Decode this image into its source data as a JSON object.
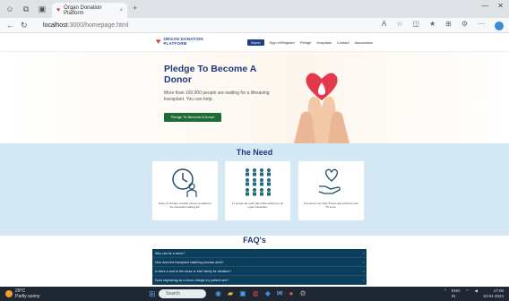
{
  "browser": {
    "tab_title": "Organ Donation Platform",
    "tab_close": "×",
    "new_tab": "+",
    "url_host": "localhost",
    "url_rest": ":3000/homepage.html",
    "win_min": "—",
    "win_close": "✕"
  },
  "site": {
    "logo_line1": "ORGAN DONATION",
    "logo_line2": "PLATFORM",
    "menu": [
      "Home",
      "Sign in/Register",
      "Pledge",
      "Hospitals",
      "Contact",
      "Association"
    ]
  },
  "hero": {
    "title": "Pledge To Become A Donor",
    "subtitle": "More than 100,000 people are waiting for a lifesaving transplant. You can help.",
    "cta": "Pledge To Become A Donor"
  },
  "need": {
    "title": "The Need",
    "cards": [
      {
        "icon": "clock-person-icon",
        "text": "Every 9 minutes, another person is added to the transplant waiting list."
      },
      {
        "icon": "people-group-icon",
        "text": "17 people die each day while waiting for an organ transplant."
      },
      {
        "icon": "heart-hand-icon",
        "text": "One donor can save 8 lives and enhance over 75 more."
      }
    ]
  },
  "faq": {
    "title": "FAQ's",
    "items": [
      "Who can be a donor?",
      "How does the transplant matching process work?",
      "Is there a cost to the donor or their family for donation?",
      "Does registering as a donor change my patient care?"
    ]
  },
  "taskbar": {
    "weather_temp": "29°C",
    "weather_desc": "Partly sunny",
    "search": "Search",
    "lang": "ENG",
    "lang2": "IN",
    "time": "17:00",
    "date": "10-04-2024"
  },
  "colors": {
    "brand": "#1f3a7a",
    "cta": "#1d6b35",
    "faq_bg": "#0c3d5a",
    "need_bg": "#d4e9f4"
  }
}
